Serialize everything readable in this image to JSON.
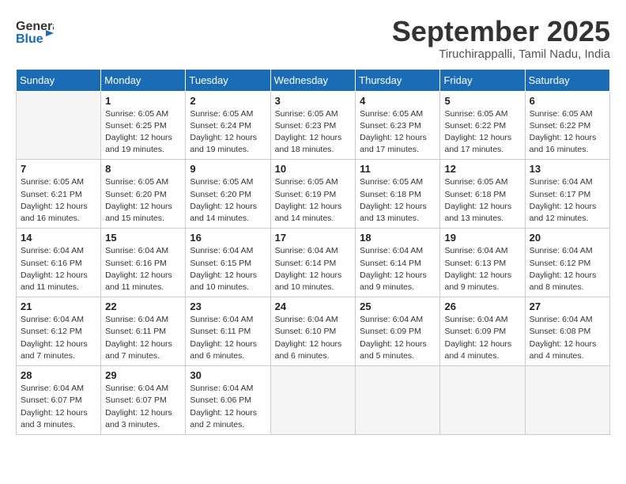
{
  "header": {
    "logo_line1": "General",
    "logo_line2": "Blue",
    "month": "September 2025",
    "location": "Tiruchirappalli, Tamil Nadu, India"
  },
  "weekdays": [
    "Sunday",
    "Monday",
    "Tuesday",
    "Wednesday",
    "Thursday",
    "Friday",
    "Saturday"
  ],
  "weeks": [
    [
      {
        "day": "",
        "info": ""
      },
      {
        "day": "1",
        "info": "Sunrise: 6:05 AM\nSunset: 6:25 PM\nDaylight: 12 hours\nand 19 minutes."
      },
      {
        "day": "2",
        "info": "Sunrise: 6:05 AM\nSunset: 6:24 PM\nDaylight: 12 hours\nand 19 minutes."
      },
      {
        "day": "3",
        "info": "Sunrise: 6:05 AM\nSunset: 6:23 PM\nDaylight: 12 hours\nand 18 minutes."
      },
      {
        "day": "4",
        "info": "Sunrise: 6:05 AM\nSunset: 6:23 PM\nDaylight: 12 hours\nand 17 minutes."
      },
      {
        "day": "5",
        "info": "Sunrise: 6:05 AM\nSunset: 6:22 PM\nDaylight: 12 hours\nand 17 minutes."
      },
      {
        "day": "6",
        "info": "Sunrise: 6:05 AM\nSunset: 6:22 PM\nDaylight: 12 hours\nand 16 minutes."
      }
    ],
    [
      {
        "day": "7",
        "info": "Sunrise: 6:05 AM\nSunset: 6:21 PM\nDaylight: 12 hours\nand 16 minutes."
      },
      {
        "day": "8",
        "info": "Sunrise: 6:05 AM\nSunset: 6:20 PM\nDaylight: 12 hours\nand 15 minutes."
      },
      {
        "day": "9",
        "info": "Sunrise: 6:05 AM\nSunset: 6:20 PM\nDaylight: 12 hours\nand 14 minutes."
      },
      {
        "day": "10",
        "info": "Sunrise: 6:05 AM\nSunset: 6:19 PM\nDaylight: 12 hours\nand 14 minutes."
      },
      {
        "day": "11",
        "info": "Sunrise: 6:05 AM\nSunset: 6:18 PM\nDaylight: 12 hours\nand 13 minutes."
      },
      {
        "day": "12",
        "info": "Sunrise: 6:05 AM\nSunset: 6:18 PM\nDaylight: 12 hours\nand 13 minutes."
      },
      {
        "day": "13",
        "info": "Sunrise: 6:04 AM\nSunset: 6:17 PM\nDaylight: 12 hours\nand 12 minutes."
      }
    ],
    [
      {
        "day": "14",
        "info": "Sunrise: 6:04 AM\nSunset: 6:16 PM\nDaylight: 12 hours\nand 11 minutes."
      },
      {
        "day": "15",
        "info": "Sunrise: 6:04 AM\nSunset: 6:16 PM\nDaylight: 12 hours\nand 11 minutes."
      },
      {
        "day": "16",
        "info": "Sunrise: 6:04 AM\nSunset: 6:15 PM\nDaylight: 12 hours\nand 10 minutes."
      },
      {
        "day": "17",
        "info": "Sunrise: 6:04 AM\nSunset: 6:14 PM\nDaylight: 12 hours\nand 10 minutes."
      },
      {
        "day": "18",
        "info": "Sunrise: 6:04 AM\nSunset: 6:14 PM\nDaylight: 12 hours\nand 9 minutes."
      },
      {
        "day": "19",
        "info": "Sunrise: 6:04 AM\nSunset: 6:13 PM\nDaylight: 12 hours\nand 9 minutes."
      },
      {
        "day": "20",
        "info": "Sunrise: 6:04 AM\nSunset: 6:12 PM\nDaylight: 12 hours\nand 8 minutes."
      }
    ],
    [
      {
        "day": "21",
        "info": "Sunrise: 6:04 AM\nSunset: 6:12 PM\nDaylight: 12 hours\nand 7 minutes."
      },
      {
        "day": "22",
        "info": "Sunrise: 6:04 AM\nSunset: 6:11 PM\nDaylight: 12 hours\nand 7 minutes."
      },
      {
        "day": "23",
        "info": "Sunrise: 6:04 AM\nSunset: 6:11 PM\nDaylight: 12 hours\nand 6 minutes."
      },
      {
        "day": "24",
        "info": "Sunrise: 6:04 AM\nSunset: 6:10 PM\nDaylight: 12 hours\nand 6 minutes."
      },
      {
        "day": "25",
        "info": "Sunrise: 6:04 AM\nSunset: 6:09 PM\nDaylight: 12 hours\nand 5 minutes."
      },
      {
        "day": "26",
        "info": "Sunrise: 6:04 AM\nSunset: 6:09 PM\nDaylight: 12 hours\nand 4 minutes."
      },
      {
        "day": "27",
        "info": "Sunrise: 6:04 AM\nSunset: 6:08 PM\nDaylight: 12 hours\nand 4 minutes."
      }
    ],
    [
      {
        "day": "28",
        "info": "Sunrise: 6:04 AM\nSunset: 6:07 PM\nDaylight: 12 hours\nand 3 minutes."
      },
      {
        "day": "29",
        "info": "Sunrise: 6:04 AM\nSunset: 6:07 PM\nDaylight: 12 hours\nand 3 minutes."
      },
      {
        "day": "30",
        "info": "Sunrise: 6:04 AM\nSunset: 6:06 PM\nDaylight: 12 hours\nand 2 minutes."
      },
      {
        "day": "",
        "info": ""
      },
      {
        "day": "",
        "info": ""
      },
      {
        "day": "",
        "info": ""
      },
      {
        "day": "",
        "info": ""
      }
    ]
  ]
}
